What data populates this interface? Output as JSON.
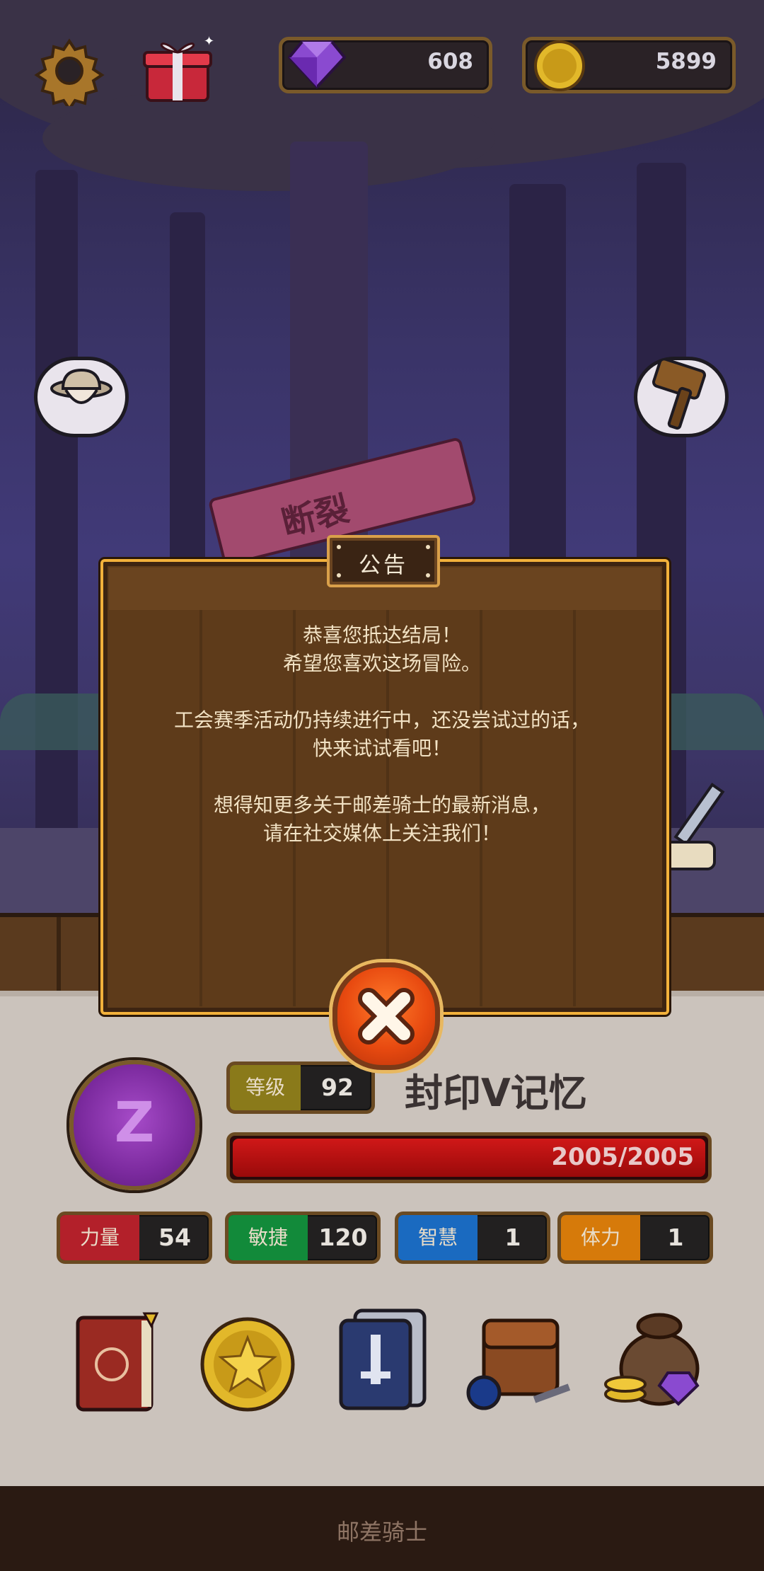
{
  "topbar": {
    "gems": "608",
    "coins": "5899"
  },
  "dialog": {
    "title": "公告",
    "paragraphs": [
      [
        "恭喜您抵达结局！",
        "希望您喜欢这场冒险。"
      ],
      [
        "工会赛季活动仍持续进行中，还没尝试过的话，",
        "快来试试看吧！"
      ],
      [
        "想得知更多关于邮差骑士的最新消息，",
        "请在社交媒体上关注我们！"
      ]
    ],
    "sign_text": "断裂"
  },
  "player": {
    "emblem_letter": "Z",
    "level_label": "等级",
    "level": "92",
    "name": "封印V记忆",
    "hp_text": "2005/2005",
    "hp_fraction": 1.0
  },
  "stats": [
    {
      "label": "力量",
      "value": "54",
      "color": "#b3202a"
    },
    {
      "label": "敏捷",
      "value": "120",
      "color": "#128a3a"
    },
    {
      "label": "智慧",
      "value": "1",
      "color": "#1a6ac0"
    },
    {
      "label": "体力",
      "value": "1",
      "color": "#d67a0a"
    }
  ],
  "toolbar_icons": [
    "book-icon",
    "star-coin-icon",
    "card-deck-icon",
    "bag-icon",
    "loot-sack-icon"
  ],
  "footer": {
    "text": "邮差骑士"
  },
  "colors": {
    "accent_gold": "#f2b13b",
    "close_orange": "#e84a10",
    "hp_red": "#d01818",
    "level_label_bg": "#8a7a1a"
  }
}
